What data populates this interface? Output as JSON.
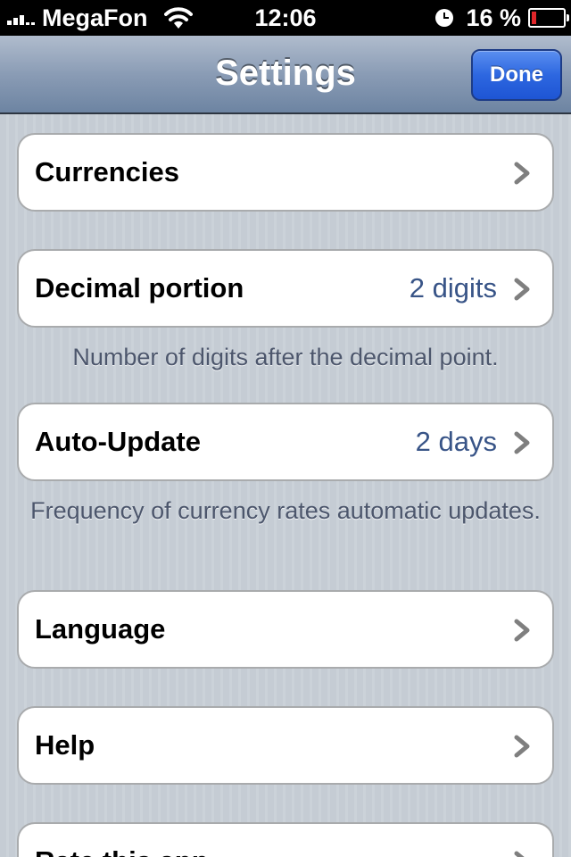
{
  "status_bar": {
    "carrier": "MegaFon",
    "time": "12:06",
    "battery_percent": "16 %",
    "battery_level": 0.16,
    "icons": [
      "signal-icon",
      "wifi-icon",
      "alarm-clock-icon",
      "battery-icon"
    ]
  },
  "nav": {
    "title": "Settings",
    "done_label": "Done"
  },
  "cells": {
    "currencies": {
      "label": "Currencies"
    },
    "decimal": {
      "label": "Decimal portion",
      "value": "2 digits",
      "footer": "Number of digits after the decimal point."
    },
    "auto_update": {
      "label": "Auto-Update",
      "value": "2 days",
      "footer": "Frequency of currency rates automatic updates."
    },
    "language": {
      "label": "Language"
    },
    "help": {
      "label": "Help"
    },
    "rate": {
      "label": "Rate this app"
    }
  },
  "colors": {
    "value_text": "#385487",
    "done_button": "#2d67e0",
    "battery_low": "#e0262a"
  }
}
